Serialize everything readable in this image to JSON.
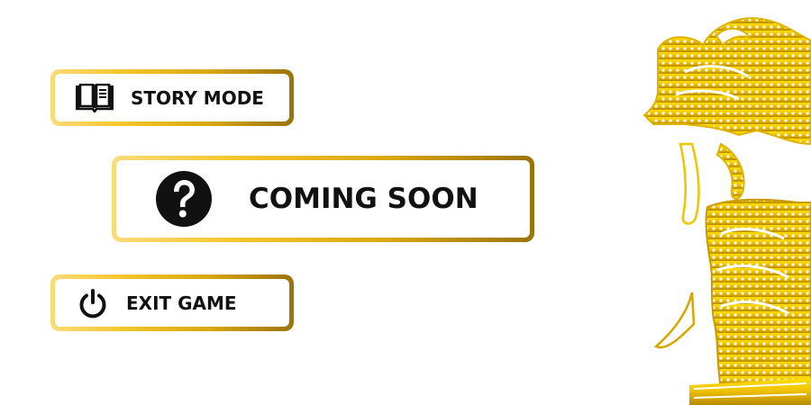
{
  "menu": {
    "story_mode": {
      "label": "STORY MODE",
      "icon": "open-book-icon"
    },
    "coming_soon": {
      "label": "COMING SOON",
      "icon": "question-circle-icon"
    },
    "exit_game": {
      "label": "EXIT GAME",
      "icon": "power-icon"
    }
  },
  "decoration": {
    "icon": "wayang-puppet-illustration"
  },
  "colors": {
    "gold_light": "#f9dc7a",
    "gold_mid": "#f4c52a",
    "gold_dark": "#9a730c",
    "text": "#111111",
    "background": "#ffffff"
  }
}
